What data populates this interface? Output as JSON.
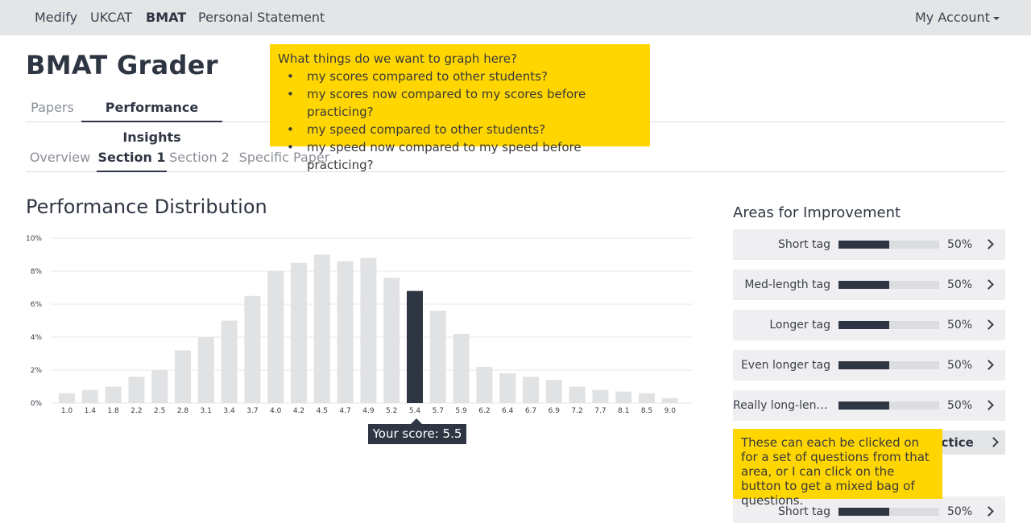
{
  "topnav": {
    "items": [
      "Medify",
      "UKCAT",
      "BMAT",
      "Personal Statement"
    ],
    "active": "BMAT",
    "account_label": "My Account"
  },
  "page_title": "BMAT Grader",
  "tabs": {
    "main": [
      "Papers",
      "Performance Insights"
    ],
    "main_active": "Performance Insights",
    "sub": [
      "Overview",
      "Section 1",
      "Section 2",
      "Specific Paper"
    ],
    "sub_active": "Section 1"
  },
  "note_graph": {
    "heading": "What things do we want to graph here?",
    "items": [
      "my scores compared to other students?",
      "my scores now compared to my scores before practicing?",
      "my speed compared to other students?",
      "my speed now compared to my speed before practicing?"
    ]
  },
  "distribution": {
    "title": "Performance Distribution",
    "tooltip": "Your score: 5.5"
  },
  "chart_data": {
    "type": "bar",
    "categories": [
      "1.0",
      "1.4",
      "1.8",
      "2.2",
      "2.5",
      "2.8",
      "3.1",
      "3.4",
      "3.7",
      "4.0",
      "4.2",
      "4.5",
      "4.7",
      "4.9",
      "5.2",
      "5.4",
      "5.7",
      "5.9",
      "6.2",
      "6.4",
      "6.7",
      "6.9",
      "7.2",
      "7.7",
      "8.1",
      "8.5",
      "9.0"
    ],
    "values": [
      0.6,
      0.8,
      1.0,
      1.6,
      2.0,
      3.2,
      4.0,
      5.0,
      6.5,
      8.0,
      8.5,
      9.0,
      8.6,
      8.8,
      7.6,
      6.8,
      5.6,
      4.2,
      2.2,
      1.8,
      1.6,
      1.4,
      1.0,
      0.8,
      0.7,
      0.6,
      0.3
    ],
    "highlight_category": "5.4",
    "y_ticks": [
      "0%",
      "2%",
      "4%",
      "6%",
      "8%",
      "10%"
    ],
    "ylim": [
      0,
      10
    ],
    "grid": true,
    "colors": {
      "bar": "#e1e2e4",
      "highlight": "#2f3643",
      "grid": "#e6e7e9",
      "tick": "#3a3f48"
    }
  },
  "areas": {
    "title": "Areas for Improvement",
    "items": [
      {
        "label": "Short tag",
        "value": 0.5,
        "pct": "50%"
      },
      {
        "label": "Med-length tag",
        "value": 0.5,
        "pct": "50%"
      },
      {
        "label": "Longer tag",
        "value": 0.5,
        "pct": "50%"
      },
      {
        "label": "Even longer tag",
        "value": 0.5,
        "pct": "50%"
      },
      {
        "label": "Really long-length tag",
        "value": 0.5,
        "pct": "50%"
      }
    ],
    "practice_label": "Practice all",
    "extra_item": {
      "label": "Short tag",
      "value": 0.5,
      "pct": "50%"
    }
  },
  "note_click": {
    "text": "These can each be clicked on for a set of questions from that area, or I can click on the button to get a mixed bag of questions."
  },
  "colors": {
    "topbar": "#e4e5e7",
    "note": "#ffd600",
    "dark": "#2f3643"
  }
}
